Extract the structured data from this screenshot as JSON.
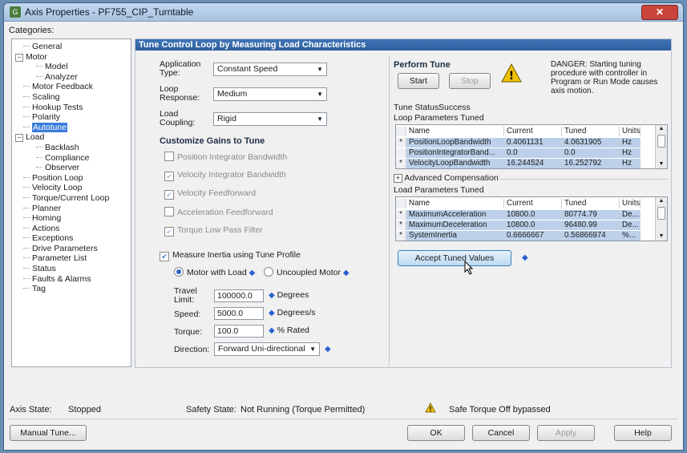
{
  "window": {
    "title": "Axis Properties - PF755_CIP_Turntable",
    "close_glyph": "✕"
  },
  "categories_label": "Categories:",
  "tree": {
    "items": [
      {
        "label": "General",
        "indent": 1,
        "expander": ""
      },
      {
        "label": "Motor",
        "indent": 0,
        "expander": "−"
      },
      {
        "label": "Model",
        "indent": 2,
        "expander": ""
      },
      {
        "label": "Analyzer",
        "indent": 2,
        "expander": ""
      },
      {
        "label": "Motor Feedback",
        "indent": 1,
        "expander": ""
      },
      {
        "label": "Scaling",
        "indent": 1,
        "expander": ""
      },
      {
        "label": "Hookup Tests",
        "indent": 1,
        "expander": ""
      },
      {
        "label": "Polarity",
        "indent": 1,
        "expander": ""
      },
      {
        "label": "Autotune",
        "indent": 1,
        "expander": "",
        "selected": true
      },
      {
        "label": "Load",
        "indent": 0,
        "expander": "−"
      },
      {
        "label": "Backlash",
        "indent": 2,
        "expander": ""
      },
      {
        "label": "Compliance",
        "indent": 2,
        "expander": ""
      },
      {
        "label": "Observer",
        "indent": 2,
        "expander": ""
      },
      {
        "label": "Position Loop",
        "indent": 1,
        "expander": ""
      },
      {
        "label": "Velocity Loop",
        "indent": 1,
        "expander": ""
      },
      {
        "label": "Torque/Current Loop",
        "indent": 1,
        "expander": ""
      },
      {
        "label": "Planner",
        "indent": 1,
        "expander": ""
      },
      {
        "label": "Homing",
        "indent": 1,
        "expander": ""
      },
      {
        "label": "Actions",
        "indent": 1,
        "expander": ""
      },
      {
        "label": "Exceptions",
        "indent": 1,
        "expander": ""
      },
      {
        "label": "Drive Parameters",
        "indent": 1,
        "expander": ""
      },
      {
        "label": "Parameter List",
        "indent": 1,
        "expander": ""
      },
      {
        "label": "Status",
        "indent": 1,
        "expander": ""
      },
      {
        "label": "Faults & Alarms",
        "indent": 1,
        "expander": ""
      },
      {
        "label": "Tag",
        "indent": 1,
        "expander": ""
      }
    ]
  },
  "panel": {
    "header": "Tune Control Loop by Measuring Load Characteristics",
    "application_type": {
      "label_1": "Application",
      "label_2": "Type:",
      "value": "Constant Speed"
    },
    "loop_response": {
      "label_1": "Loop",
      "label_2": "Response:",
      "value": "Medium"
    },
    "load_coupling": {
      "label_1": "Load",
      "label_2": "Coupling:",
      "value": "Rigid"
    },
    "customize_title": "Customize Gains to Tune",
    "gains": [
      {
        "label": "Position Integrator Bandwidth",
        "checked": false
      },
      {
        "label": "Velocity Integrator Bandwidth",
        "checked": true
      },
      {
        "label": "Velocity Feedforward",
        "checked": true
      },
      {
        "label": "Acceleration Feedforward",
        "checked": false
      },
      {
        "label": "Torque Low Pass Filter",
        "checked": true
      }
    ],
    "measure_inertia": {
      "label": "Measure Inertia using Tune Profile",
      "checked": true
    },
    "motor_with_load": "Motor with Load",
    "uncoupled_motor": "Uncoupled Motor",
    "travel_limit": {
      "label_1": "Travel",
      "label_2": "Limit:",
      "value": "100000.0",
      "unit": "Degrees"
    },
    "speed": {
      "label": "Speed:",
      "value": "5000.0",
      "unit": "Degrees/s"
    },
    "torque": {
      "label": "Torque:",
      "value": "100.0",
      "unit": "% Rated"
    },
    "direction": {
      "label": "Direction:",
      "value": "Forward Uni-directional"
    },
    "perform_tune": "Perform Tune",
    "start": "Start",
    "stop": "Stop",
    "danger": "DANGER: Starting tuning procedure with controller in Program or Run Mode causes axis motion.",
    "tune_status_label": "Tune Status:",
    "tune_status_value": "Success",
    "loop_params_title": "Loop Parameters Tuned",
    "load_params_title": "Load Parameters Tuned",
    "advanced_comp": "Advanced Compensation",
    "accept": "Accept Tuned Values",
    "table_headers": {
      "name": "Name",
      "current": "Current",
      "tuned": "Tuned",
      "units": "Units"
    },
    "loop_rows": [
      {
        "marker": "*",
        "name": "PositionLoopBandwidth",
        "current": "0.4061131",
        "tuned": "4.0631905",
        "units": "Hz"
      },
      {
        "marker": "",
        "name": "PositionIntegratorBand...",
        "current": "0.0",
        "tuned": "0.0",
        "units": "Hz"
      },
      {
        "marker": "*",
        "name": "VelocityLoopBandwidth",
        "current": "16.244524",
        "tuned": "16.252792",
        "units": "Hz"
      }
    ],
    "load_rows": [
      {
        "marker": "*",
        "name": "MaximumAcceleration",
        "current": "10800.0",
        "tuned": "80774.79",
        "units": "De..."
      },
      {
        "marker": "*",
        "name": "MaximumDeceleration",
        "current": "10800.0",
        "tuned": "96480.99",
        "units": "De..."
      },
      {
        "marker": "*",
        "name": "SystemInertia",
        "current": "0.6666667",
        "tuned": "0.56866974",
        "units": "%..."
      }
    ]
  },
  "status_bar": {
    "axis_state_label": "Axis State:",
    "axis_state_value": "Stopped",
    "safety_state_label": "Safety State:",
    "safety_state_value": "Not Running (Torque Permitted)",
    "safe_torque": "Safe Torque Off bypassed"
  },
  "buttons": {
    "manual_tune": "Manual Tune...",
    "ok": "OK",
    "cancel": "Cancel",
    "apply": "Apply",
    "help": "Help"
  },
  "colors": {
    "header_blue": "#2f5f9c",
    "selection": "#3b7ddb",
    "warning": "#f2c200",
    "row_highlight": "#bcd0ea"
  }
}
